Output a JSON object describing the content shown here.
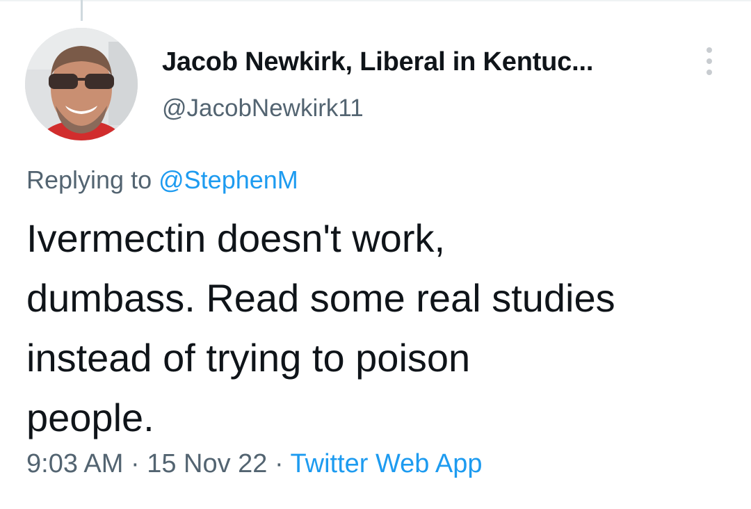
{
  "tweet": {
    "author": {
      "display_name": "Jacob Newkirk, Liberal in Kentuc...",
      "handle": "@JacobNewkirk11",
      "avatar_icon": "user-avatar-photo"
    },
    "more_icon": "more-vertical-icon",
    "replying_prefix": "Replying to",
    "replying_to": "@StephenM",
    "text": "Ivermectin doesn't work,\ndumbass. Read some real studies\ninstead of trying to poison\npeople.",
    "time": "9:03 AM",
    "separator": "·",
    "date": "15 Nov 22",
    "source": "Twitter Web App"
  },
  "colors": {
    "primary_text": "#0f1419",
    "secondary_text": "#536471",
    "link": "#1d9bf0",
    "background": "#ffffff"
  }
}
